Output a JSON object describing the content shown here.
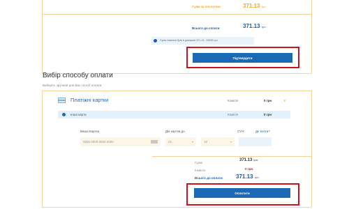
{
  "top_summary": {
    "to_pay_label": "Сума за послугою:",
    "to_pay_value": "371.13",
    "to_pay_currency": "грн",
    "total_label": "Всього до сплати",
    "total_value": "371.13",
    "total_currency": "грн",
    "notice_text": "Сума повинна бути в діапазоні 371.13 - 24999 грн.",
    "confirm_button": "Підтвердити"
  },
  "payment_section": {
    "title": "Вибір способу оплати",
    "subtitle": "Виберіть зручний для Вас спосіб оплати",
    "method_title": "Платіжні картки",
    "commission_label": "Комісія",
    "commission_value": "0 грн",
    "row_label": "Інша карта",
    "row_commission_label": "Комісія",
    "row_commission_value": "0 грн",
    "card_label": "Ваша Картка",
    "card_placeholder": "0000 0000 0000 0000",
    "expiry_label": "Дія картки до",
    "expiry_month": "01",
    "expiry_year": "18",
    "cvv_label": "CVV:",
    "cvv_help": "Де взяти?",
    "sum_label": "Сума",
    "sum_value": "371.13",
    "sum_currency": "грн.",
    "fee_label": "Комісія",
    "fee_value": "0 грн.",
    "total_label": "Всього до оплати",
    "total_value": "371.13",
    "total_currency": "грн.",
    "pay_button": "Оплатити"
  },
  "colors": {
    "accent_orange": "#f6a623",
    "primary_blue": "#1a69b5",
    "highlight_red": "#d0121b"
  }
}
